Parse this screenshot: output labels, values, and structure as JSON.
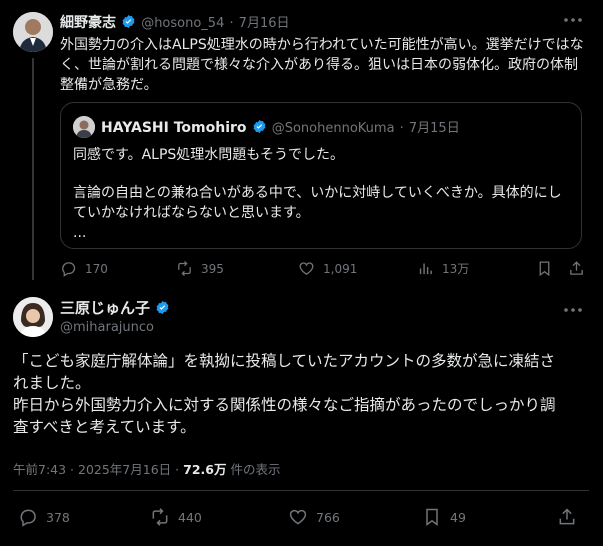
{
  "tweet1": {
    "display_name": "細野豪志",
    "handle": "@hosono_54",
    "separator": "·",
    "date": "7月16日",
    "text_lines": [
      "外国勢力の介入はALPS処理水の時から行われていた可能性が高い。選挙だけではな",
      "く、世論が割れる問題で様々な介入があり得る。狙いは日本の弱体化。政府の体制",
      "整備が急務だ。"
    ],
    "quote": {
      "display_name": "HAYASHI Tomohiro",
      "handle": "@SonohennoKuma",
      "separator": "·",
      "date": "7月15日",
      "line1": "同感です。ALPS処理水問題もそうでした。",
      "line2": "言論の自由との兼ね合いがある中で、いかに対峙していくべきか。具体的にし",
      "line3": "ていかなければならないと思います。",
      "line4": "..."
    },
    "actions": {
      "replies": "170",
      "reposts": "395",
      "likes": "1,091",
      "views": "13万"
    }
  },
  "tweet2": {
    "display_name": "三原じゅん子",
    "handle": "@miharajunco",
    "text_lines": [
      "「こども家庭庁解体論」を執拗に投稿していたアカウントの多数が急に凍結さ",
      "れました。",
      "昨日から外国勢力介入に対する関係性の様々なご指摘があったのでしっかり調",
      "査すべきと考えています。"
    ],
    "timestamp": "午前7:43 · 2025年7月16日",
    "meta_sep": "·",
    "views_count": "72.6万",
    "views_label": "件の表示",
    "actions": {
      "replies": "378",
      "reposts": "440",
      "likes": "766",
      "bookmarks": "49"
    }
  },
  "colors": {
    "background": "#000000",
    "text": "#e7e9ea",
    "muted": "#71767b",
    "verified": "#1d9bf0",
    "border": "#2f3336"
  }
}
